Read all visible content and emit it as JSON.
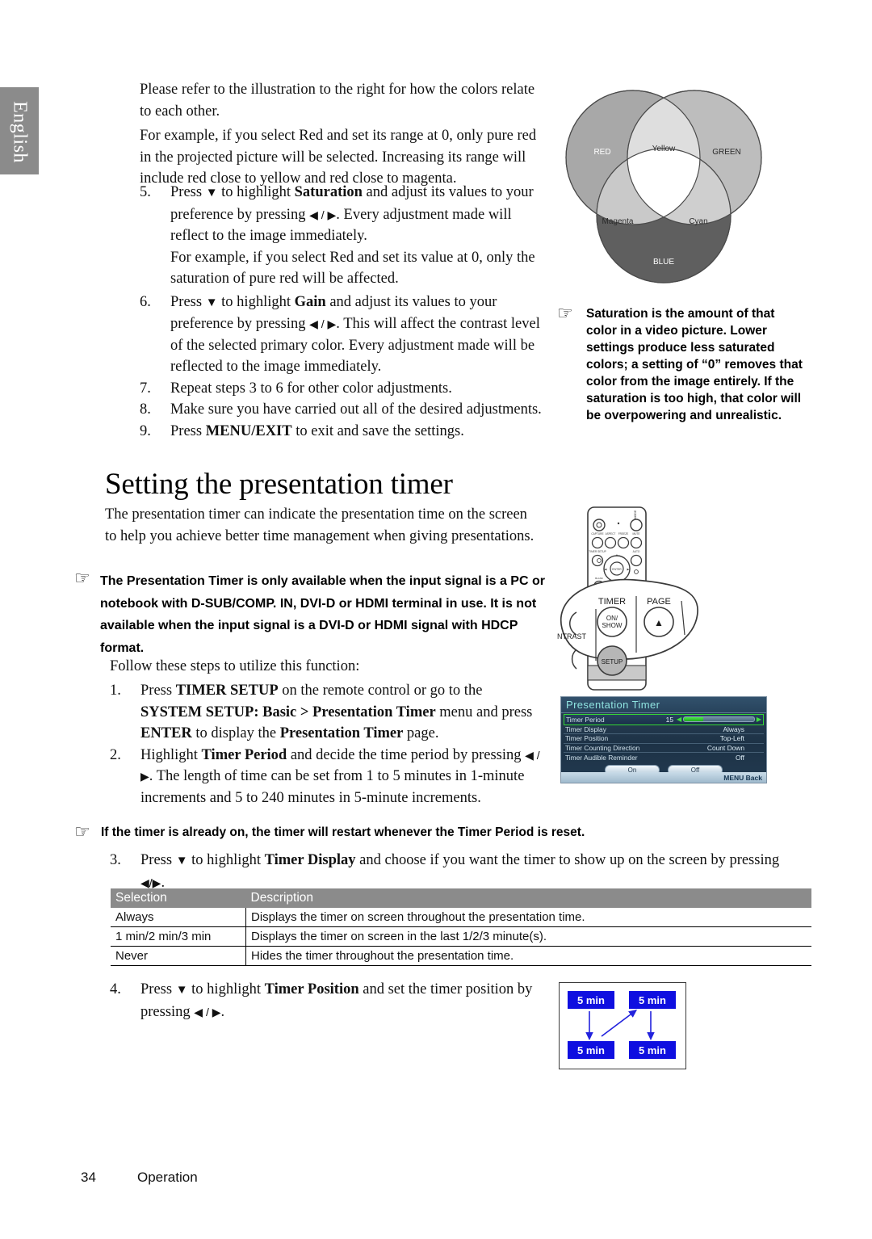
{
  "language_tab": "English",
  "intro": {
    "p1": "Please refer to the illustration to the right for how the colors relate to each other.",
    "p2": "For example, if you select Red and set its range at 0, only pure red in the projected picture will be selected. Increasing its range will include red close to yellow and red close to magenta."
  },
  "steps_color": [
    {
      "num": "5.",
      "text_a": "Press ",
      "arrow_down": "▼",
      "text_b": " to highlight ",
      "bold1": "Saturation",
      "text_c": " and adjust its values to your preference by pressing ",
      "arrows": "◀ / ▶",
      "text_d": ". Every adjustment made will reflect to the image immediately.",
      "sub": "For example, if you select Red and set its value at 0, only the saturation of pure red will be affected."
    },
    {
      "num": "6.",
      "text_a": "Press ",
      "arrow_down": "▼",
      "text_b": " to highlight ",
      "bold1": "Gain",
      "text_c": " and adjust its values to your preference by pressing ",
      "arrows": "◀ / ▶",
      "text_d": ". This will affect the contrast level of the selected primary color. Every adjustment made will be reflected to the image immediately."
    },
    {
      "num": "7.",
      "plain": "Repeat steps 3 to 6 for other color adjustments."
    },
    {
      "num": "8.",
      "plain": "Make sure you have carried out all of the desired adjustments."
    },
    {
      "num": "9.",
      "text_a": "Press ",
      "bold1": "MENU/EXIT",
      "text_d": " to exit and save the settings."
    }
  ],
  "venn": {
    "labels": {
      "red": "RED",
      "green": "GREEN",
      "blue": "BLUE",
      "yellow": "Yellow",
      "magenta": "Magenta",
      "cyan": "Cyan"
    },
    "colors": {
      "red_fill": "#a8a8a8",
      "green_fill": "#bdbdbd",
      "blue_fill": "#5f5f5f",
      "yellow_fill": "#dedede",
      "magenta_fill": "#c9c9c9",
      "cyan_fill": "#cfcfcf",
      "center_fill": "#ffffff",
      "stroke": "#4a4a4a"
    }
  },
  "note_saturation": {
    "icon": "pointing-hand",
    "glyph": "☞",
    "text": "Saturation is the amount of that color in a video picture. Lower settings produce less saturated colors; a setting of “0” removes that color from the image entirely. If the saturation is too high, that color will be overpowering and unrealistic."
  },
  "section": {
    "heading": "Setting the presentation timer",
    "intro": "The presentation timer can indicate the presentation time on the screen to help you achieve better time management when giving presentations."
  },
  "note_availability": {
    "icon": "pointing-hand",
    "glyph": "☞",
    "text": "The Presentation Timer is only available when the input signal is a PC or notebook with D-SUB/COMP. IN, DVI-D or HDMI  terminal in use. It is not available when the input signal is a DVI-D or HDMI signal with HDCP format."
  },
  "follow_line": "Follow these steps to utilize this function:",
  "steps_timer": [
    {
      "num": "1.",
      "t1": "Press ",
      "b1": "TIMER SETUP",
      "t2": " on the remote control or go to the ",
      "b2": "SYSTEM SETUP: Basic > Presentation Timer",
      "t3": " menu and press ",
      "b3": "ENTER",
      "t4": " to display the ",
      "b4": "Presentation Timer",
      "t5": " page."
    },
    {
      "num": "2.",
      "t1": "Highlight ",
      "b1": "Timer Period",
      "t2": " and decide the time period by pressing ",
      "arrows": "◀ / ▶",
      "t3": ". The length of time can be set from 1 to 5 minutes in 1-minute increments and 5 to 240 minutes in 5-minute increments."
    }
  ],
  "note_restart": {
    "icon": "pointing-hand",
    "glyph": "☞",
    "text": "If the timer is already on, the timer will restart whenever the Timer Period is reset."
  },
  "step3": {
    "num": "3.",
    "t1": "Press ",
    "arrow_down": "▼",
    "t2": " to highlight ",
    "b1": "Timer Display",
    "t3": " and choose if you want the timer to show up on the screen by pressing",
    "arrows": "◀/▶",
    "t4": "."
  },
  "step4": {
    "num": "4.",
    "t1": "Press ",
    "arrow_down": "▼",
    "t2": " to highlight ",
    "b1": "Timer Position",
    "t3": " and set the timer position by pressing ",
    "arrows": "◀ / ▶",
    "t4": "."
  },
  "table": {
    "headers": [
      "Selection",
      "Description"
    ],
    "rows": [
      [
        "Always",
        "Displays the timer on screen throughout the presentation time."
      ],
      [
        "1 min/2 min/3 min",
        "Displays the timer on screen in the last 1/2/3 minute(s)."
      ],
      [
        "Never",
        "Hides the timer throughout the presentation time."
      ]
    ]
  },
  "osd": {
    "title": "Presentation Timer",
    "rows": [
      {
        "label": "Timer Period",
        "value": "15",
        "type": "slider",
        "highlighted": true,
        "fill_percent": 28
      },
      {
        "label": "Timer Display",
        "value": "Always",
        "type": "value",
        "highlighted": false
      },
      {
        "label": "Timer Position",
        "value": "Top-Left",
        "type": "value",
        "highlighted": false
      },
      {
        "label": "Timer Counting Direction",
        "value": "Count Down",
        "type": "value",
        "highlighted": false
      },
      {
        "label": "Timer Audible Reminder",
        "value": "Off",
        "type": "value",
        "highlighted": false
      }
    ],
    "buttons": [
      "On",
      "Off"
    ],
    "footer": "MENU Back",
    "colors": {
      "title_text": "#8fe3e0",
      "highlight_border": "#35d635",
      "background": "#22384d"
    }
  },
  "remote": {
    "label_timer": "TIMER",
    "label_page": "PAGE",
    "btn_on_show_line1": "ON/",
    "btn_on_show_line2": "SHOW",
    "btn_setup": "SETUP",
    "label_contrast": "NTRAST",
    "page_arrow": "▲"
  },
  "position_diagram": {
    "cells": [
      "5 min",
      "5 min",
      "5 min",
      "5 min"
    ],
    "box_color": "#0f0fe0",
    "text_color": "#ffffff",
    "arrow_color": "#2222dd"
  },
  "footer": {
    "page_number": "34",
    "section_name": "Operation"
  }
}
